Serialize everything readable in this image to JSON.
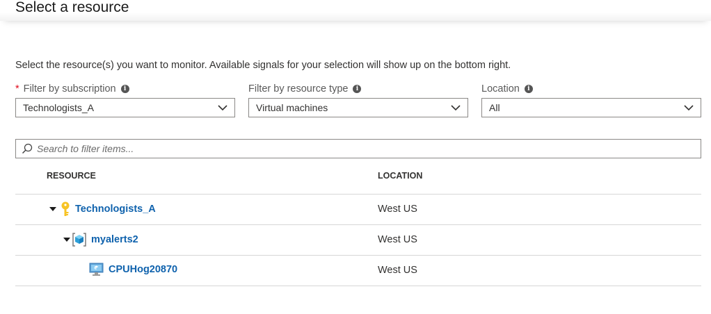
{
  "title": "Select a resource",
  "description": "Select the resource(s) you want to monitor. Available signals for your selection will show up on the bottom right.",
  "filters": {
    "subscription": {
      "required_mark": "*",
      "label": "Filter by subscription",
      "value": "Technologists_A"
    },
    "resource_type": {
      "label": "Filter by resource type",
      "value": "Virtual machines"
    },
    "location": {
      "label": "Location",
      "value": "All"
    }
  },
  "search": {
    "placeholder": "Search to filter items..."
  },
  "table": {
    "columns": {
      "resource": "RESOURCE",
      "location": "LOCATION"
    },
    "rows": [
      {
        "name": "Technologists_A",
        "location": "West US",
        "icon": "key-icon"
      },
      {
        "name": "myalerts2",
        "location": "West US",
        "icon": "resource-group-icon"
      },
      {
        "name": "CPUHog20870",
        "location": "West US",
        "icon": "virtual-machine-icon"
      }
    ]
  },
  "colors": {
    "link": "#0f62ad",
    "required": "#e00b1c",
    "border": "#8a8886"
  }
}
